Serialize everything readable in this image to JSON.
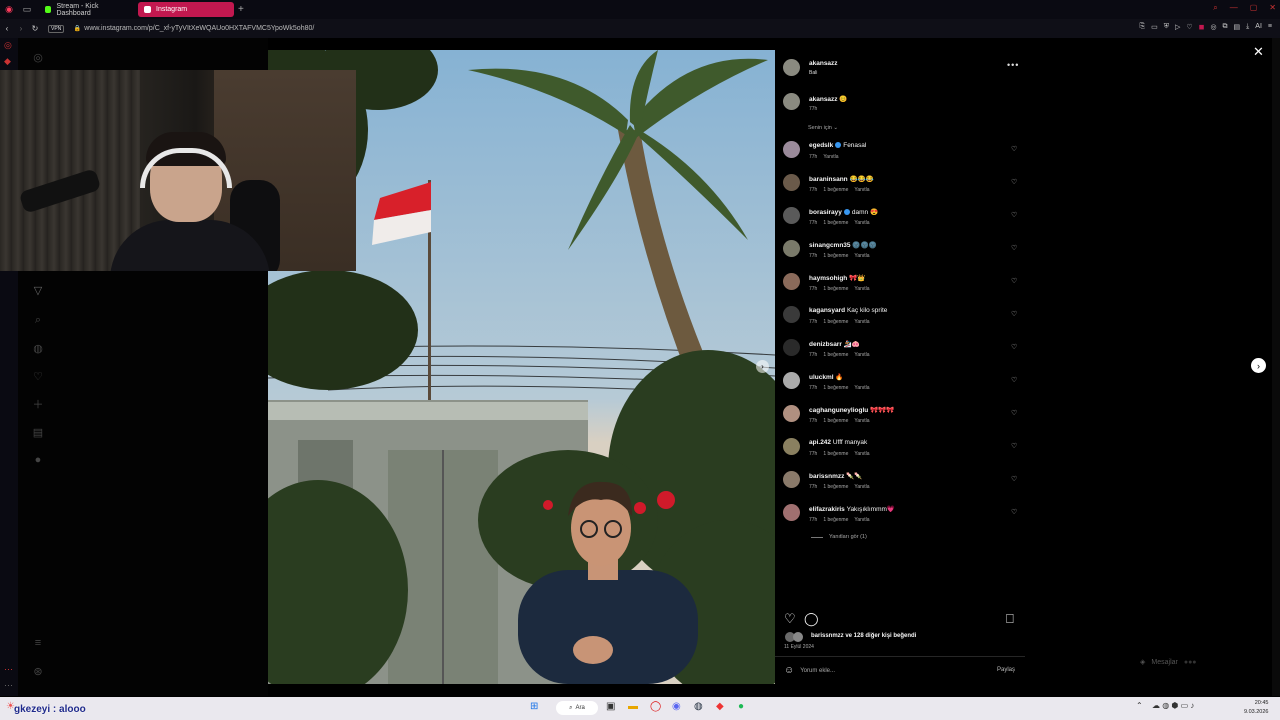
{
  "browser": {
    "tabs": [
      {
        "label": "Stream - Kick Dashboard",
        "color": "#53fc18",
        "active": false
      },
      {
        "label": "Instagram",
        "color": "#ffffff",
        "active": true
      }
    ],
    "url": "www.instagram.com/p/C_xf-yTyVItXeWQAUo0HXTAFVMC5YpoWk5oh80/",
    "vpn_label": "VPN",
    "ai_label": "AI"
  },
  "post": {
    "author": "akansazz",
    "location": "Bali",
    "caption_user": "akansazz",
    "caption_emoji": "😊",
    "caption_time": "77h",
    "sort_label": "Senin için",
    "comments": [
      {
        "user": "egedslk",
        "verified": true,
        "text": "Fenasal",
        "time": "77h",
        "likes": "",
        "reply": "Yanıtla"
      },
      {
        "user": "baraninsann",
        "verified": false,
        "text": "😂😂😂",
        "time": "77h",
        "likes": "1 beğenme",
        "reply": "Yanıtla"
      },
      {
        "user": "borasirayy",
        "verified": true,
        "text": "damn 😍",
        "time": "77h",
        "likes": "1 beğenme",
        "reply": "Yanıtla"
      },
      {
        "user": "sinangcmn35",
        "verified": false,
        "text": "🌚🌚🌚",
        "time": "77h",
        "likes": "1 beğenme",
        "reply": "Yanıtla"
      },
      {
        "user": "haymsohigh",
        "verified": false,
        "text": "🎀👑",
        "time": "77h",
        "likes": "1 beğenme",
        "reply": "Yanıtla"
      },
      {
        "user": "kagansyard",
        "verified": false,
        "text": "Kaç kilo sprite",
        "time": "77h",
        "likes": "1 beğenme",
        "reply": "Yanıtla"
      },
      {
        "user": "denizbsarr",
        "verified": false,
        "text": "🏂🐽",
        "time": "77h",
        "likes": "1 beğenme",
        "reply": "Yanıtla"
      },
      {
        "user": "uluckml",
        "verified": false,
        "text": "🔥",
        "time": "77h",
        "likes": "1 beğenme",
        "reply": "Yanıtla"
      },
      {
        "user": "caghanguneylioglu",
        "verified": false,
        "text": "🎀🎀🎀",
        "time": "77h",
        "likes": "1 beğenme",
        "reply": "Yanıtla"
      },
      {
        "user": "api.242",
        "verified": false,
        "text": "Ufff manyak",
        "time": "77h",
        "likes": "1 beğenme",
        "reply": "Yanıtla"
      },
      {
        "user": "barissnmzz",
        "verified": false,
        "text": "🍡🍡",
        "time": "77h",
        "likes": "1 beğenme",
        "reply": "Yanıtla"
      },
      {
        "user": "elifazrakiris",
        "verified": false,
        "text": "Yakışıklımmm💗",
        "time": "77h",
        "likes": "1 beğenme",
        "reply": "Yanıtla"
      }
    ],
    "more_replies": "Yanıtları gör (1)",
    "likes_summary": "barissnmzz ve 128 diğer kişi beğendi",
    "date": "11 Eylül 2024",
    "comment_placeholder": "Yorum ekle...",
    "share_label": "Paylaş"
  },
  "side": {
    "messages_label": "Mesajlar"
  },
  "stream_overlay": "gkezeyi : alooo",
  "taskbar": {
    "search_label": "Ara",
    "time": "20:45",
    "date": "9.03.2026"
  },
  "colors": {
    "accent": "#c2184f",
    "verified": "#3897f0",
    "like_red": "#ff3040"
  }
}
